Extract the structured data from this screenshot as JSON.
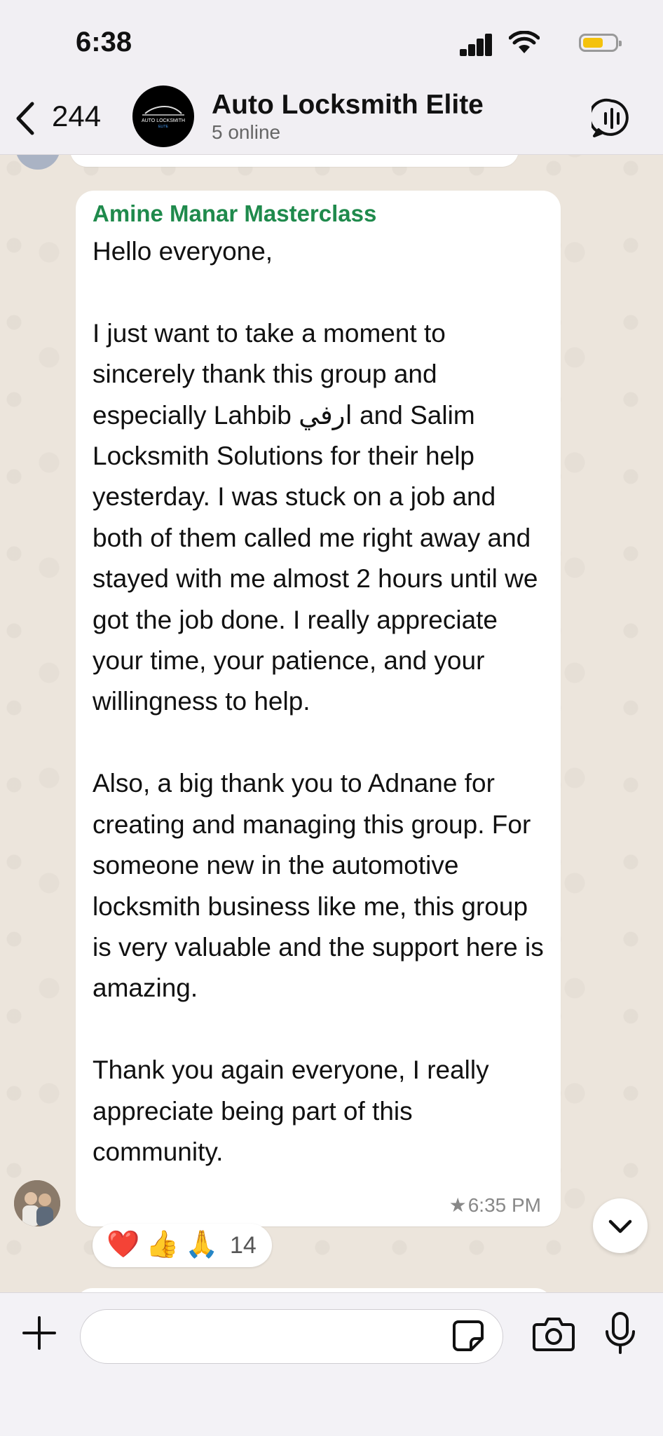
{
  "status_bar": {
    "time": "6:38"
  },
  "header": {
    "back_count": "244",
    "group_name": "Auto Locksmith Elite",
    "group_status": "5 online",
    "avatar_text_top": "AUTO LOCKSMITH",
    "avatar_text_bottom": "ELITE"
  },
  "message": {
    "sender": "Amine Manar Masterclass",
    "text": "Hello everyone,\n\nI just want to take a moment to sincerely thank this group and especially Lahbib ارفي and Salim Locksmith Solutions for their help yesterday. I was stuck on a job and both of them called me right away and stayed with me almost 2 hours until we got the job done. I really appreciate your time, your patience, and your willingness to help.\n\nAlso, a big thank you to Adnane for creating and managing this group. For someone new in the automotive locksmith business like me, this group is very valuable and the support here is amazing.\n\nThank you again everyone, I really appreciate being part of this community.",
    "time": "6:35 PM",
    "starred": true,
    "reactions": {
      "emojis": [
        "❤️",
        "👍",
        "🙏"
      ],
      "count": "14"
    }
  },
  "colors": {
    "sender_name": "#1f8a4c",
    "bubble": "#ffffff",
    "wallpaper": "#ece5dc"
  },
  "icons": [
    "back-chevron-icon",
    "call-waveform-icon",
    "chevron-down-icon",
    "plus-icon",
    "sticker-icon",
    "camera-icon",
    "microphone-icon",
    "star-icon"
  ]
}
